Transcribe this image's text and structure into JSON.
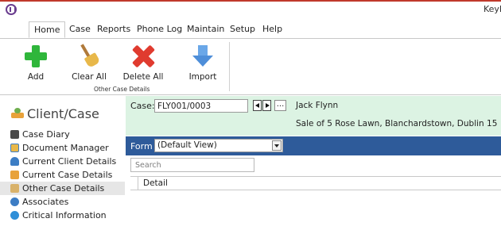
{
  "app": {
    "user_partial": "Keyh"
  },
  "menu": {
    "tabs": [
      {
        "label": "Home",
        "active": true
      },
      {
        "label": "Case"
      },
      {
        "label": "Reports"
      },
      {
        "label": "Phone Log"
      },
      {
        "label": "Maintain"
      },
      {
        "label": "Setup"
      },
      {
        "label": "Help"
      }
    ]
  },
  "ribbon": {
    "buttons": [
      {
        "label": "Add",
        "icon": "plus-icon"
      },
      {
        "label": "Clear All",
        "icon": "broom-icon"
      },
      {
        "label": "Delete All",
        "icon": "delete-x-icon"
      },
      {
        "label": "Import",
        "icon": "down-arrow-icon"
      }
    ],
    "group_label": "Other Case Details"
  },
  "sidebar": {
    "title": "Client/Case",
    "items": [
      {
        "label": "Case Diary",
        "icon": "diary-icon"
      },
      {
        "label": "Document Manager",
        "icon": "document-icon"
      },
      {
        "label": "Current Client Details",
        "icon": "client-icon"
      },
      {
        "label": "Current Case Details",
        "icon": "case-icon"
      },
      {
        "label": "Other Case Details",
        "icon": "other-case-icon",
        "selected": true
      },
      {
        "label": "Associates",
        "icon": "associates-icon"
      },
      {
        "label": "Critical Information",
        "icon": "info-icon"
      }
    ]
  },
  "case": {
    "label": "Case:",
    "number": "FLY001/0003",
    "more_label": "...",
    "client_name": "Jack Flynn",
    "description": "Sale of 5 Rose Lawn, Blanchardstown, Dublin 15"
  },
  "form": {
    "label": "Form",
    "selected_view": "(Default View)"
  },
  "search": {
    "placeholder": "Search"
  },
  "grid": {
    "columns": [
      "Detail"
    ]
  },
  "colors": {
    "accent_red": "#c0392b",
    "case_panel": "#dcf3e3",
    "form_bar": "#2e5b9a",
    "selected_row": "#e6e6e6"
  }
}
